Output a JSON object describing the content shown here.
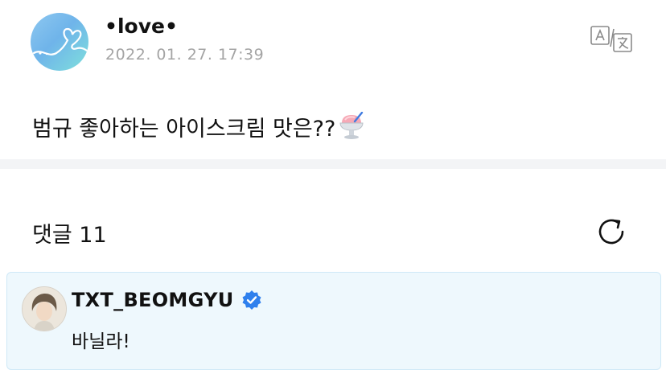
{
  "post": {
    "author": "•love•",
    "timestamp": "2022. 01. 27. 17:39",
    "text": "범규 좋아하는 아이스크림 맛은??",
    "emoji_icon": "shaved-ice-icon"
  },
  "toolbar": {
    "translate_icon": "translate-icon"
  },
  "comments": {
    "title": "댓글 11",
    "refresh_icon": "refresh-icon",
    "items": [
      {
        "author": "TXT_BEOMGYU",
        "verified": true,
        "text": "바닐라!"
      }
    ]
  },
  "colors": {
    "timestamp": "#a4a4a4",
    "divider": "#f3f4f6",
    "highlight_bg": "#eef8fd",
    "verified_badge": "#2f80ed"
  }
}
